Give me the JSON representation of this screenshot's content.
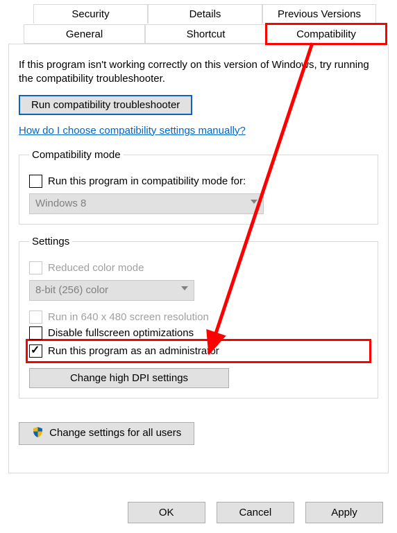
{
  "tabs": {
    "row1": {
      "security": "Security",
      "details": "Details",
      "previous": "Previous Versions"
    },
    "row2": {
      "general": "General",
      "shortcut": "Shortcut",
      "compat": "Compatibility"
    }
  },
  "intro": "If this program isn't working correctly on this version of Windows, try running the compatibility troubleshooter.",
  "troubleshooter_button": "Run compatibility troubleshooter",
  "manual_link": "How do I choose compatibility settings manually?",
  "compat_group": {
    "legend": "Compatibility mode",
    "checkbox_label": "Run this program in compatibility mode for:",
    "combo_value": "Windows 8"
  },
  "settings_group": {
    "legend": "Settings",
    "reduced_color": "Reduced color mode",
    "color_combo": "8-bit (256) color",
    "run_640": "Run in 640 x 480 screen resolution",
    "disable_fs": "Disable fullscreen optimizations",
    "run_admin": "Run this program as an administrator",
    "high_dpi": "Change high DPI settings"
  },
  "all_users_button": "Change settings for all users",
  "buttons": {
    "ok": "OK",
    "cancel": "Cancel",
    "apply": "Apply"
  }
}
